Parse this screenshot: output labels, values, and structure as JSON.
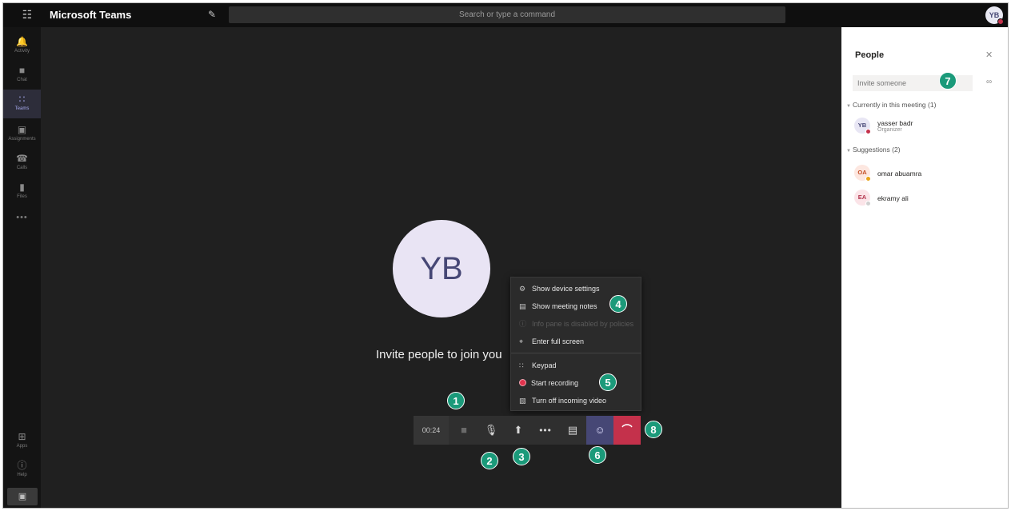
{
  "titlebar": {
    "app_title": "Microsoft Teams",
    "search_placeholder": "Search or type a command",
    "user_initials": "YB"
  },
  "rail": {
    "items": [
      {
        "label": "Activity",
        "icon": "bell-icon",
        "glyph": "🔔"
      },
      {
        "label": "Chat",
        "icon": "chat-icon",
        "glyph": "■"
      },
      {
        "label": "Teams",
        "icon": "teams-icon",
        "glyph": "∷"
      },
      {
        "label": "Assignments",
        "icon": "assignments-icon",
        "glyph": "▣"
      },
      {
        "label": "Calls",
        "icon": "phone-icon",
        "glyph": "☎"
      },
      {
        "label": "Files",
        "icon": "file-icon",
        "glyph": "▮"
      }
    ],
    "more_glyph": "•••",
    "apps_label": "Apps",
    "help_label": "Help"
  },
  "stage": {
    "avatar_initials": "YB",
    "invite_text": "Invite people to join you"
  },
  "menu": {
    "items": [
      {
        "label": "Show device settings",
        "icon": "gear-icon",
        "glyph": "⚙",
        "enabled": true
      },
      {
        "label": "Show meeting notes",
        "icon": "notes-icon",
        "glyph": "▤",
        "enabled": true
      },
      {
        "label": "Info pane is disabled by policies",
        "icon": "info-icon",
        "glyph": "ⓘ",
        "enabled": false
      },
      {
        "label": "Enter full screen",
        "icon": "fullscreen-icon",
        "glyph": "⌖",
        "enabled": true
      },
      {
        "label": "Keypad",
        "icon": "keypad-icon",
        "glyph": "∷",
        "enabled": true
      },
      {
        "label": "Start recording",
        "icon": "record-icon",
        "glyph": "",
        "enabled": true
      },
      {
        "label": "Turn off incoming video",
        "icon": "video-off-icon",
        "glyph": "▧",
        "enabled": true
      }
    ]
  },
  "controls": {
    "timer": "00:24",
    "video_glyph": "■",
    "mic_glyph": "🎙",
    "share_glyph": "⬆",
    "more_glyph": "•••",
    "chat_glyph": "▤",
    "people_glyph": "☺",
    "hangup_glyph": "⌒"
  },
  "badges": [
    "1",
    "2",
    "3",
    "4",
    "5",
    "6",
    "7",
    "8"
  ],
  "panel": {
    "title": "People",
    "close_glyph": "✕",
    "invite_placeholder": "Invite someone",
    "link_glyph": "∞",
    "current_section": "Currently in this meeting (1)",
    "suggestions_section": "Suggestions (2)",
    "participants": [
      {
        "initials": "YB",
        "name": "yasser badr",
        "role": "Organizer",
        "avatar_bg": "#e8e6f4",
        "avatar_fg": "#464775",
        "status_color": "#c4314b"
      }
    ],
    "suggestions": [
      {
        "initials": "OA",
        "name": "omar abuamra",
        "avatar_bg": "#fde7e0",
        "avatar_fg": "#c24a21",
        "status_color": "#e8a317"
      },
      {
        "initials": "EA",
        "name": "ekramy ali",
        "avatar_bg": "#fbe4e8",
        "avatar_fg": "#b3354e",
        "status_color": "#d0d0d0"
      }
    ]
  },
  "colors": {
    "accent": "#464775",
    "hangup": "#c4314b",
    "badge": "#1b9a7a"
  }
}
